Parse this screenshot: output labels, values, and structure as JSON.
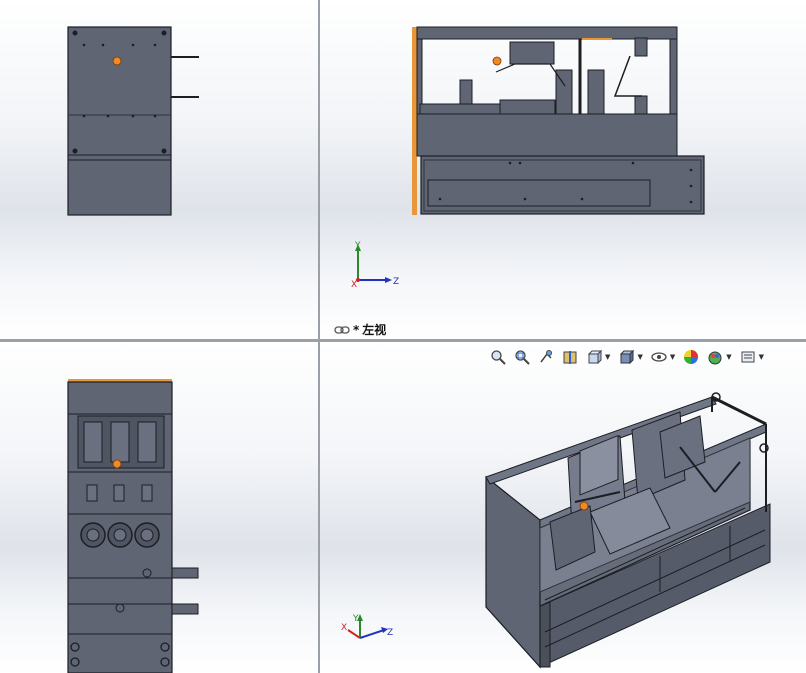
{
  "viewports": {
    "top_left": {
      "name": "front"
    },
    "top_right": {
      "label_prefix": "*",
      "label": "左视",
      "active": true
    },
    "bottom_left": {
      "name": "top"
    },
    "bottom_right": {
      "name": "isometric"
    }
  },
  "triad": {
    "x": "Z",
    "y": "Y",
    "z": "X"
  },
  "heads_up_toolbar": [
    {
      "icon": "zoom-to-fit-icon",
      "dropdown": false
    },
    {
      "icon": "zoom-to-area-icon",
      "dropdown": false
    },
    {
      "icon": "previous-view-icon",
      "dropdown": false
    },
    {
      "icon": "section-view-icon",
      "dropdown": false
    },
    {
      "icon": "view-orientation-icon",
      "dropdown": true
    },
    {
      "icon": "display-style-icon",
      "dropdown": true
    },
    {
      "icon": "hide-show-items-icon",
      "dropdown": true
    },
    {
      "icon": "edit-appearance-icon",
      "dropdown": false
    },
    {
      "icon": "apply-scene-icon",
      "dropdown": true
    },
    {
      "icon": "view-settings-icon",
      "dropdown": true
    }
  ],
  "colors": {
    "model_body": "#5f6573",
    "model_edge": "#1c1e24",
    "highlight_edge": "#e8963a",
    "marker": "#f08a24",
    "axis_x": "#cc2222",
    "axis_y": "#2a8a2a",
    "axis_z": "#2233bb"
  }
}
